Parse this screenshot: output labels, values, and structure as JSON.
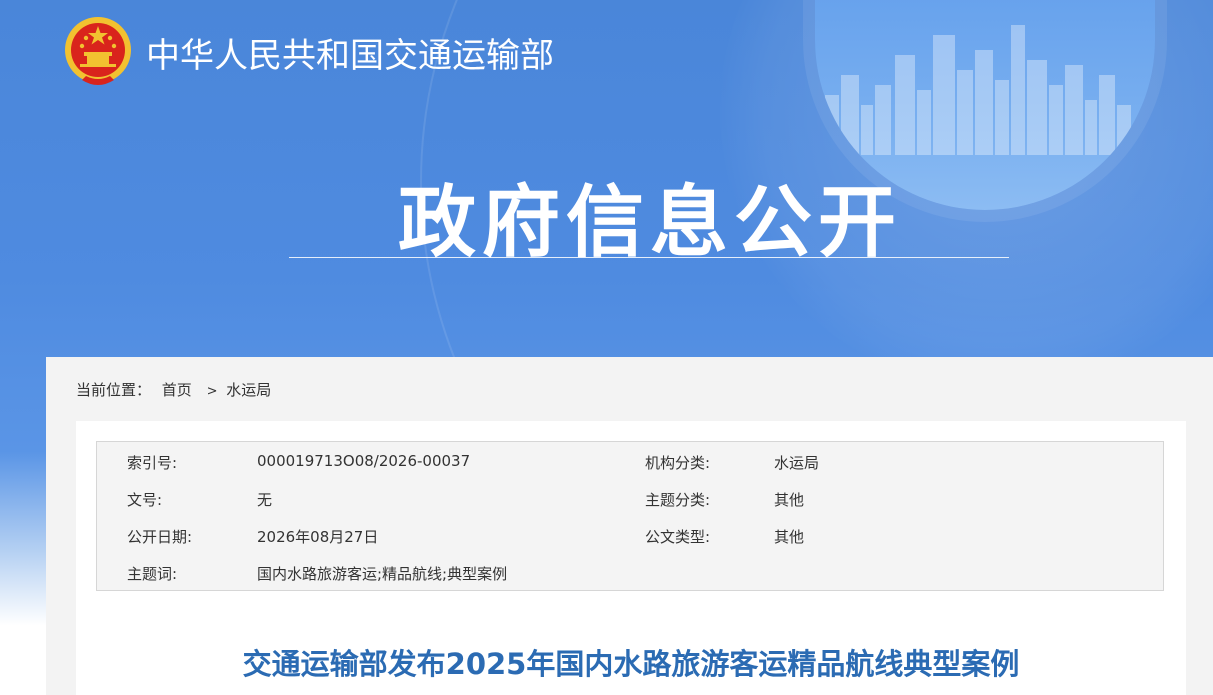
{
  "header": {
    "ministry_name": "中华人民共和国交通运输部",
    "section_title": "政府信息公开",
    "emblem_icon": "national-emblem-icon",
    "brand_color": "#4a86d9"
  },
  "breadcrumb": {
    "label": "当前位置：",
    "home": "首页",
    "separator": ">",
    "current": "水运局"
  },
  "metadata": [
    {
      "label1": "索引号:",
      "value1": "000019713O08/2026-00037",
      "label2": "机构分类:",
      "value2": "水运局"
    },
    {
      "label1": "文号:",
      "value1": "无",
      "label2": "主题分类:",
      "value2": "其他"
    },
    {
      "label1": "公开日期:",
      "value1": "2026年08月27日",
      "label2": "公文类型:",
      "value2": "其他"
    },
    {
      "label1": "主题词:",
      "value1": "国内水路旅游客运;精品航线;典型案例",
      "label2": "",
      "value2": ""
    }
  ],
  "document": {
    "title": "交通运输部发布2025年国内水路旅游客运精品航线典型案例",
    "title_color": "#2b6bb3"
  }
}
